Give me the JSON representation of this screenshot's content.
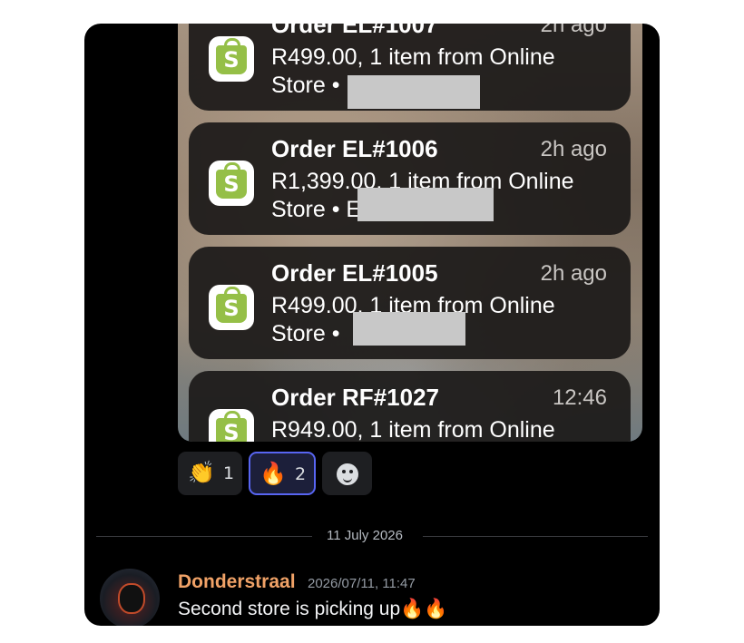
{
  "notifications": [
    {
      "title": "Order EL#1007",
      "time": "2h ago",
      "body_line1": "R499.00, 1 item from Online",
      "body_line2": "Store •"
    },
    {
      "title": "Order EL#1006",
      "time": "2h ago",
      "body_line1": "R1,399.00, 1 item from Online",
      "body_line2": "Store • E"
    },
    {
      "title": "Order EL#1005",
      "time": "2h ago",
      "body_line1": "R499.00, 1 item from Online",
      "body_line2": "Store •"
    },
    {
      "title": "Order RF#1027",
      "time": "12:46",
      "body_line1": "R949.00, 1 item from Online",
      "body_line2": ""
    }
  ],
  "app_icon": {
    "name": "shopify-bag-icon",
    "letter": "S",
    "color": "#95bf47"
  },
  "reactions": [
    {
      "emoji": "👏",
      "count": "1",
      "active": false
    },
    {
      "emoji": "🔥",
      "count": "2",
      "active": true
    }
  ],
  "add_reaction_icon": "smiley-add-reaction-icon",
  "date_divider": "11 July 2026",
  "message": {
    "username": "Donderstraal",
    "timestamp": "2026/07/11, 11:47",
    "text": "Second store is picking up🔥🔥"
  },
  "colors": {
    "username": "#f0a267",
    "active_reaction_border": "#5865f2",
    "background": "#000000"
  }
}
